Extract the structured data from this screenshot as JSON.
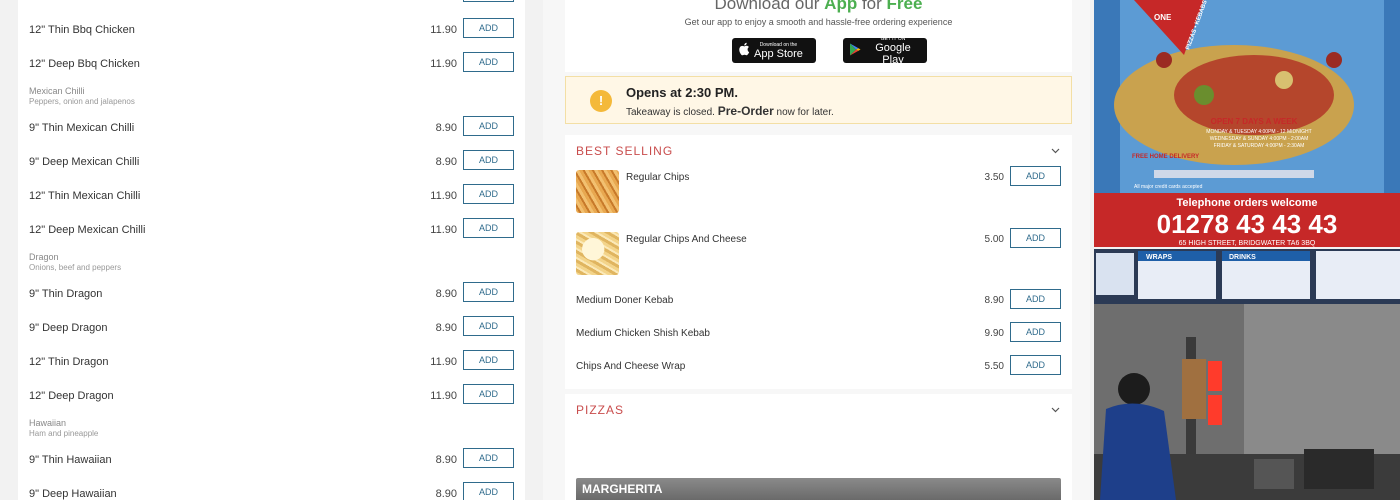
{
  "left_menu": {
    "rows": [
      {
        "name": "12\" Thin Bbq Chicken",
        "price": "11.90",
        "add": "ADD"
      },
      {
        "name": "12\" Deep Bbq Chicken",
        "price": "11.90",
        "add": "ADD"
      },
      {
        "name": "9\" Thin Mexican Chilli",
        "price": "8.90",
        "add": "ADD"
      },
      {
        "name": "9\" Deep Mexican Chilli",
        "price": "8.90",
        "add": "ADD"
      },
      {
        "name": "12\" Thin Mexican Chilli",
        "price": "11.90",
        "add": "ADD"
      },
      {
        "name": "12\" Deep Mexican Chilli",
        "price": "11.90",
        "add": "ADD"
      },
      {
        "name": "9\" Thin Dragon",
        "price": "8.90",
        "add": "ADD"
      },
      {
        "name": "9\" Deep Dragon",
        "price": "8.90",
        "add": "ADD"
      },
      {
        "name": "12\" Thin Dragon",
        "price": "11.90",
        "add": "ADD"
      },
      {
        "name": "12\" Deep Dragon",
        "price": "11.90",
        "add": "ADD"
      },
      {
        "name": "9\" Thin Hawaiian",
        "price": "8.90",
        "add": "ADD"
      },
      {
        "name": "9\" Deep Hawaiian",
        "price": "8.90",
        "add": "ADD"
      }
    ],
    "categories": [
      {
        "title": "Mexican Chilli",
        "desc": "Peppers, onion and jalapenos"
      },
      {
        "title": "Dragon",
        "desc": "Onions, beef and peppers"
      },
      {
        "title": "Hawaiian",
        "desc": "Ham and pineapple"
      }
    ]
  },
  "app_promo": {
    "headline_pre": "Download our",
    "headline_app": "App",
    "headline_mid": "for",
    "headline_free": "Free",
    "sub": "Get our app to enjoy a smooth and hassle-free ordering experience",
    "appstore_small": "Download on the",
    "appstore_big": "App Store",
    "googleplay_small": "GET IT ON",
    "googleplay_big": "Google Play"
  },
  "status": {
    "opens": "Opens at 2:30 PM.",
    "closed_text": "Takeaway is closed.",
    "preorder": "Pre-Order",
    "later": "now for later.",
    "icon": "!"
  },
  "best_selling": {
    "title": "BEST SELLING",
    "items": [
      {
        "name": "Regular Chips",
        "price": "3.50",
        "add": "ADD"
      },
      {
        "name": "Regular Chips And Cheese",
        "price": "5.00",
        "add": "ADD"
      },
      {
        "name": "Medium Doner Kebab",
        "price": "8.90",
        "add": "ADD"
      },
      {
        "name": "Medium Chicken Shish Kebab",
        "price": "9.90",
        "add": "ADD"
      },
      {
        "name": "Chips And Cheese Wrap",
        "price": "5.50",
        "add": "ADD"
      }
    ]
  },
  "pizzas": {
    "title": "PIZZAS",
    "first_item": "MARGHERITA"
  },
  "flyer": {
    "phone": "01278 43 43 43",
    "telephone_orders": "Telephone orders welcome",
    "open_days": "OPEN 7 DAYS A WEEK",
    "credit_cards": "All major credit cards accepted",
    "address": "65 HIGH STREET, BRIDGWATER TA6 3BQ",
    "hours_1": "MONDAY & TUESDAY 4:00PM - 12 MIDNIGHT",
    "hours_2": "WEDNESDAY & SUNDAY 4:00PM - 2:00AM",
    "hours_3": "FRIDAY & SATURDAY 4:00PM - 2:30AM",
    "free_delivery": "FREE HOME DELIVERY",
    "banner": "PIZZAS • KEBABS • BURGERS",
    "badge": "ONE"
  },
  "shop": {
    "board_1": "WRAPS",
    "board_2": "DRINKS"
  },
  "colors": {
    "accent_blue": "#2f6b8c",
    "section_red": "#c94d4d",
    "promo_green": "#4caf50",
    "warning_yellow": "#f4b93a"
  }
}
